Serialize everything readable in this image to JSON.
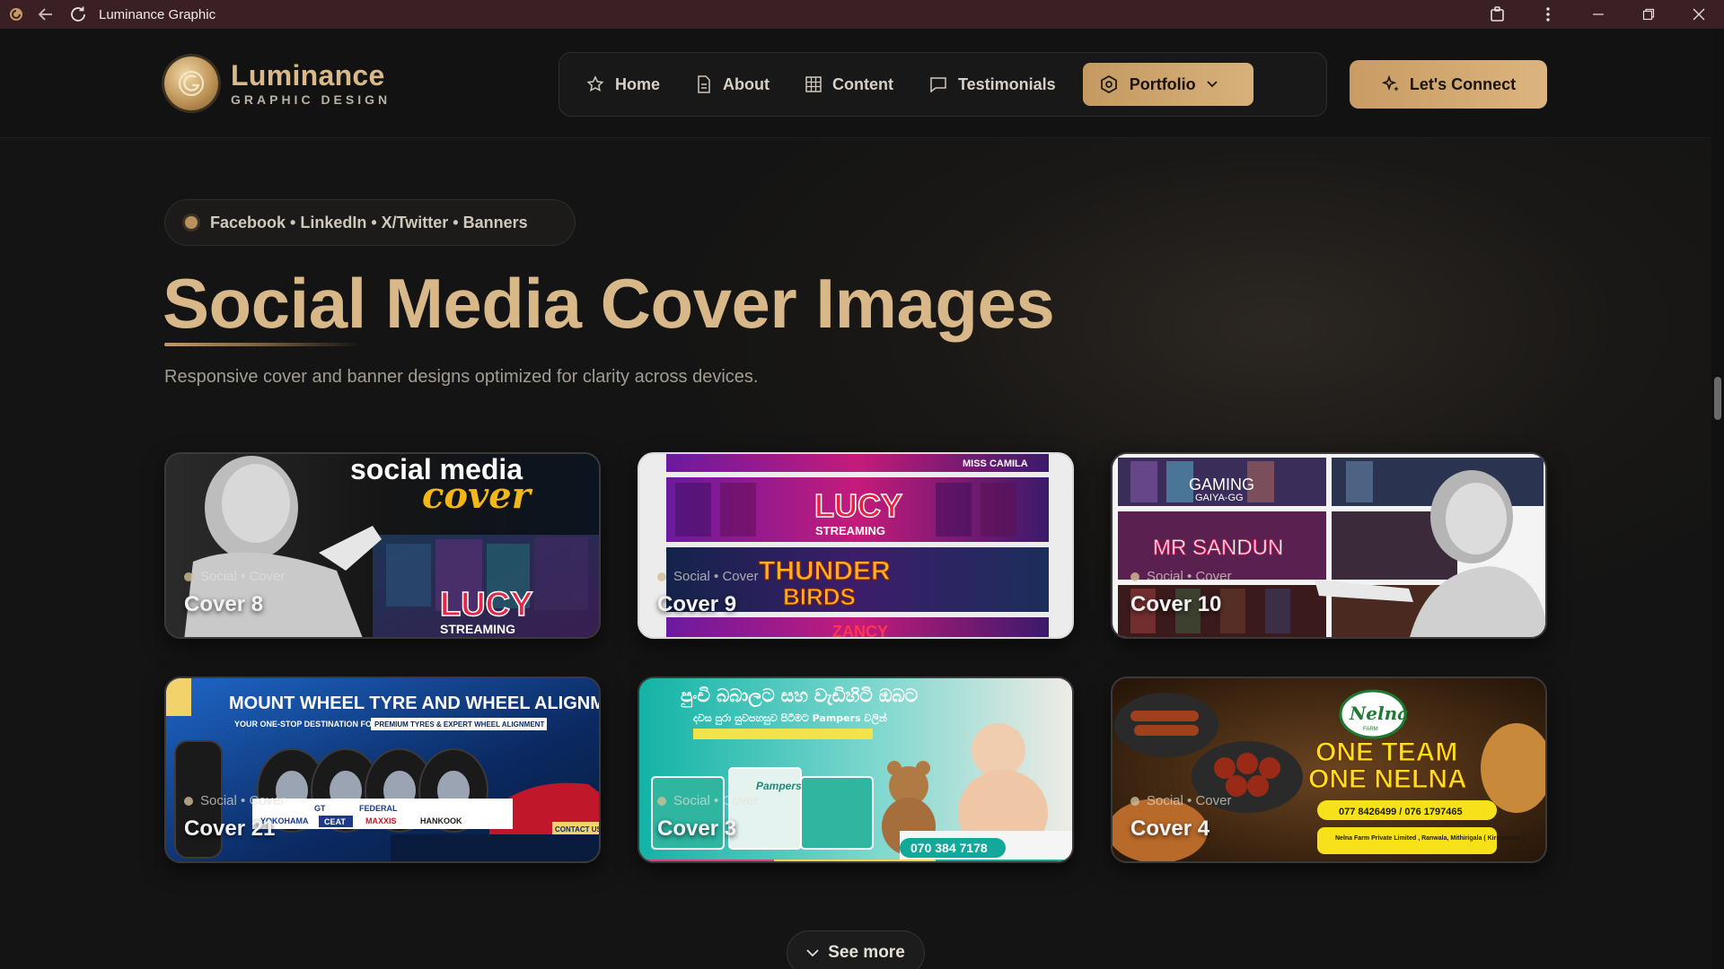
{
  "window": {
    "title": "Luminance Graphic"
  },
  "brand": {
    "name": "Luminance",
    "tagline": "GRAPHIC DESIGN"
  },
  "nav": {
    "items": [
      {
        "label": "Home",
        "icon": "star-icon"
      },
      {
        "label": "About",
        "icon": "document-icon"
      },
      {
        "label": "Content",
        "icon": "grid-icon"
      },
      {
        "label": "Testimonials",
        "icon": "chat-icon"
      }
    ],
    "active": {
      "label": "Portfolio",
      "icon": "portfolio-icon"
    },
    "cta": "Let's Connect"
  },
  "hero": {
    "pill": "Facebook • LinkedIn • X/Twitter • Banners",
    "heading": "Social Media Cover Images",
    "subtitle": "Responsive cover and banner designs optimized for clarity across devices."
  },
  "cards": [
    {
      "meta": "Social • Cover",
      "title": "Cover 8",
      "art": {
        "headline": "social media",
        "script": "cover",
        "badge": "LUCY",
        "badge_sub": "STREAMING"
      }
    },
    {
      "meta": "Social • Cover",
      "title": "Cover 9",
      "art": {
        "top": "MISS CAMILA",
        "banner1": "LUCY",
        "banner1_sub": "STREAMING",
        "banner2": "THUNDER",
        "banner2_sub": "BIRDS",
        "footer": "ZANCY"
      }
    },
    {
      "meta": "Social • Cover",
      "title": "Cover 10",
      "art": {
        "tag1": "GAMING",
        "tag1_sub": "GAIYA-GG",
        "tag2": "MR SANDUN"
      }
    },
    {
      "meta": "Social • Cover",
      "title": "Cover 21",
      "art": {
        "headline": "MOUNT WHEEL TYRE AND WHEEL ALIGNMENT",
        "subline": "YOUR ONE-STOP DESTINATION FOR",
        "highlight": "PREMIUM TYRES & EXPERT WHEEL ALIGNMENT",
        "contact": "CONTACT US",
        "brands": [
          "GT",
          "FEDERAL",
          "YOKOHAMA",
          "CEAT",
          "MAXXIS",
          "HANKOOK"
        ]
      }
    },
    {
      "meta": "Social • Cover",
      "title": "Cover 3",
      "art": {
        "headline": "පුංචි බබාලට සහ වැඩිහිටි ඔබට",
        "subline": "දවස පුරා සුවපහසුව පිටිමට Pampers වලින්",
        "brand": "Pampers",
        "phone": "070 384 7178"
      }
    },
    {
      "meta": "Social • Cover",
      "title": "Cover 4",
      "art": {
        "brand": "Nelna",
        "brand_sub": "FARM",
        "line1": "ONE TEAM",
        "line2": "ONE NELNA",
        "phone": "077 8426499 / 076 1797465",
        "address": "Nelna Farm Private Limited , Ranwala, Mithirigala ( Kirindiwala )"
      }
    }
  ],
  "see_more": "See more"
}
